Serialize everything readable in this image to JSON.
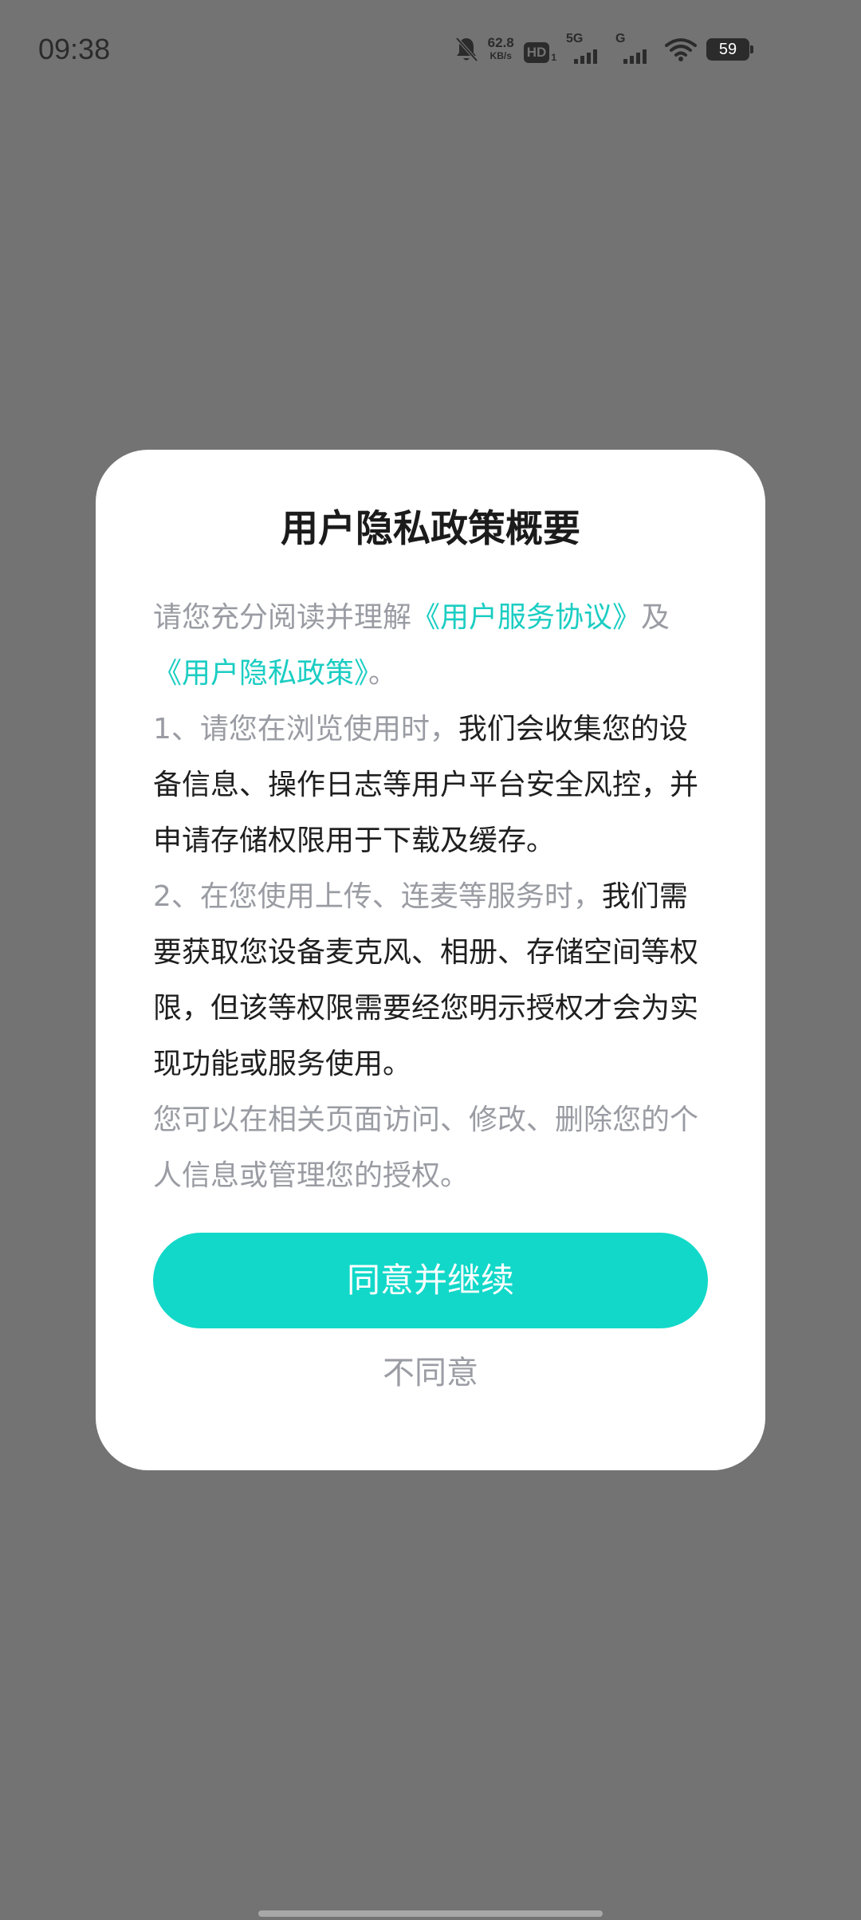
{
  "status_bar": {
    "time": "09:38",
    "net_speed_value": "62.8",
    "net_speed_unit": "KB/s",
    "hd_label": "HD",
    "hd_sub": "1",
    "signal1_label": "5G",
    "signal2_label": "G",
    "battery": "59",
    "icons": [
      "mute-bell-icon",
      "wifi-icon"
    ]
  },
  "dialog": {
    "title": "用户隐私政策概要",
    "intro_prefix": "请您充分阅读并理解",
    "service_link": "《用户服务协议》",
    "intro_and": "及",
    "privacy_link": "《用户隐私政策》",
    "intro_end": "。",
    "item1_prefix": "1、请您在浏览使用时，",
    "item1_body": "我们会收集您的设备信息、操作日志等用户平台安全风控，并申请存储权限用于下载及缓存。",
    "item2_prefix": "2、在您使用上传、连麦等服务时，",
    "item2_body": "我们需要获取您设备麦克风、相册、存储空间等权限，但该等权限需要经您明示授权才会为实现功能或服务使用。",
    "footer_text": "您可以在相关页面访问、修改、删除您的个人信息或管理您的授权。",
    "agree_label": "同意并继续",
    "disagree_label": "不同意"
  },
  "colors": {
    "accent": "#12d8c9",
    "link": "#1bcdc2",
    "muted_text": "#9a9ca3",
    "overlay": "#737373"
  }
}
